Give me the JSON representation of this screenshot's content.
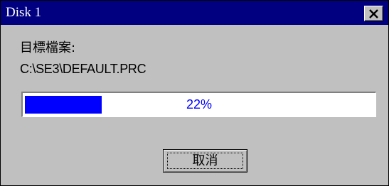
{
  "window": {
    "title": "Disk 1",
    "close_icon": "close-icon"
  },
  "body": {
    "target_label": "目標檔案:",
    "file_path": "C:\\SE3\\DEFAULT.PRC"
  },
  "progress": {
    "value": 0.22,
    "text": "22%"
  },
  "buttons": {
    "cancel_label": "取消"
  },
  "colors": {
    "titlebar": "#000080",
    "face": "#c0c0c0",
    "progress_fill": "#0000ff",
    "progress_text": "#0000ff"
  }
}
